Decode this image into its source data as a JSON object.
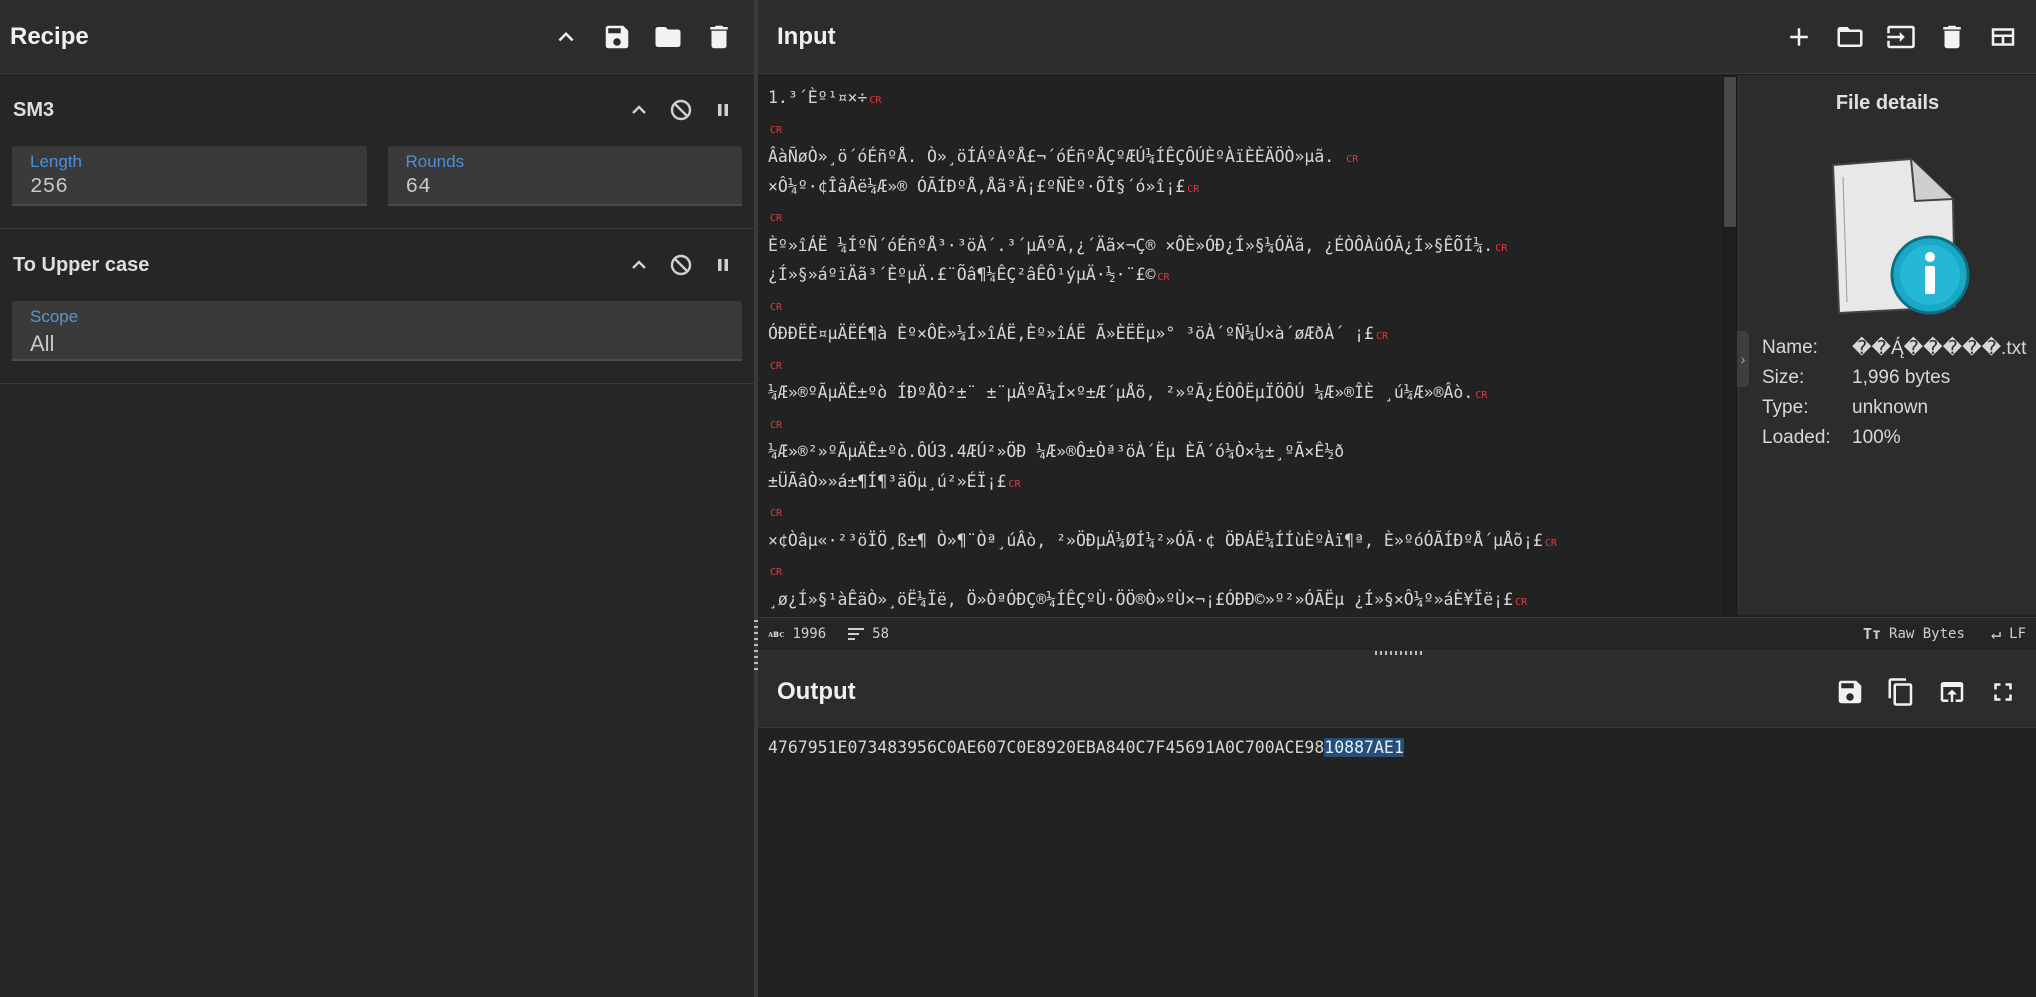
{
  "recipe": {
    "title": "Recipe",
    "operations": [
      {
        "name": "SM3",
        "args": [
          {
            "label": "Length",
            "value": "256"
          },
          {
            "label": "Rounds",
            "value": "64"
          }
        ]
      },
      {
        "name": "To Upper case",
        "args": [
          {
            "label": "Scope",
            "value": "All"
          }
        ]
      }
    ]
  },
  "input": {
    "title": "Input",
    "lines": [
      "1.³´Èº¹¤×÷",
      "",
      "ÂàÑøÒ»¸ö´óÉñºÅ. Ò»¸öÍÁºÀºÅ£¬´óÉñºÅÇºÆÚ¼ÍÊÇÔÚÈºÀïÈÈÄÖÒ»µã. ",
      "×Ô¼º·¢ÎâÂë¼Æ»® ÓÃÍÐºÅ,Åã³Ä¡£ºÑÈº·ÕÎ§´ó»î¡£",
      "",
      "Èº»îÁË ¼ÍºÑ´óÉñºÅ³·³öÀ´.³´µÃºÃ,¿´Äã×¬Ç® ×ÔÈ»ÓÐ¿Í»§¼ÓÄã, ¿ÉÒÔÀûÓÃ¿Í»§ÊÕÍ¼.",
      "¿Í»§»áºïÄã³´ÈºµÄ.£¨Õâ¶¼ÊÇ²âÊÔ¹ýµÄ·½·¨£©",
      "",
      "ÓÐÐËÈ¤µÄËÉ¶à Èº×ÔÈ»¼Í»îÁË,Èº»îÁË Ã»ÈËËµ»° ³öÀ´ºÑ¼Ú×à´øÆðÀ´ ¡£",
      "",
      "¼Æ»®ºÃµÄÊ±ºò ÍÐºÅÒ²±¨ ±¨µÄºÃ¼Í×º±Æ´µÅõ, ²»ºÃ¿ÉÒÔËµÏÖÔÚ ¼Æ»®ÎÈ ¸ú¼Æ»®Âò.",
      "",
      "¼Æ»®²»ºÃµÄÊ±ºò.ÔÚ3.4ÆÚ²»ÖÐ ¼Æ»®Ô±Òª³öÀ´Ëµ ÈÃ´ó¼Ò×¼±¸ºÃ×Ê½ð",
      "±ÜÃâÒ»»á±¶Í¶³äÖµ¸ú²»ÉÏ¡£",
      "",
      "×¢Òâµ«·²³öÏÖ¸ß±¶ Ò»¶¨Òª¸úÂò, ²»ÖÐµÄ¼ØÍ¼²»ÓÃ·¢ ÖÐÁË¼ÍÍùÈºÀï¶ª, È»ºóÓÃÍÐºÅ´µÅõ¡£",
      "",
      "¸ø¿Í»§¹àÊäÒ»¸öË¼Ïë, Ö»ÒªÓÐÇ®¼ÍÊÇºÙ·ÖÖ®Ò»ºÙ×¬¡£ÓÐÐ©»º²»ÓÃËµ ¿Í»§×Ô¼º»áÈ¥Ïë¡£"
    ],
    "cr_lines": [
      0,
      1,
      2,
      3,
      4,
      5,
      6,
      7,
      8,
      9,
      10,
      11,
      13,
      14,
      15,
      16,
      17
    ],
    "file_details": {
      "title": "File details",
      "name_label": "Name:",
      "name_value": "��Ą́�����.txt",
      "size_label": "Size:",
      "size_value": "1,996 bytes",
      "type_label": "Type:",
      "type_value": "unknown",
      "loaded_label": "Loaded:",
      "loaded_value": "100%"
    },
    "status": {
      "chars": "1996",
      "lines": "58",
      "encoding": "Raw Bytes",
      "eol": "LF"
    }
  },
  "output": {
    "title": "Output",
    "text_plain": "4767951E073483956C0AE607C0E8920EBA840C7F45691A0C700ACE98",
    "text_selected": "10887AE1"
  },
  "colors": {
    "accent": "#4a90d9",
    "cr_marker": "#e03a3a",
    "selection": "#264f78",
    "background": "#222222"
  }
}
